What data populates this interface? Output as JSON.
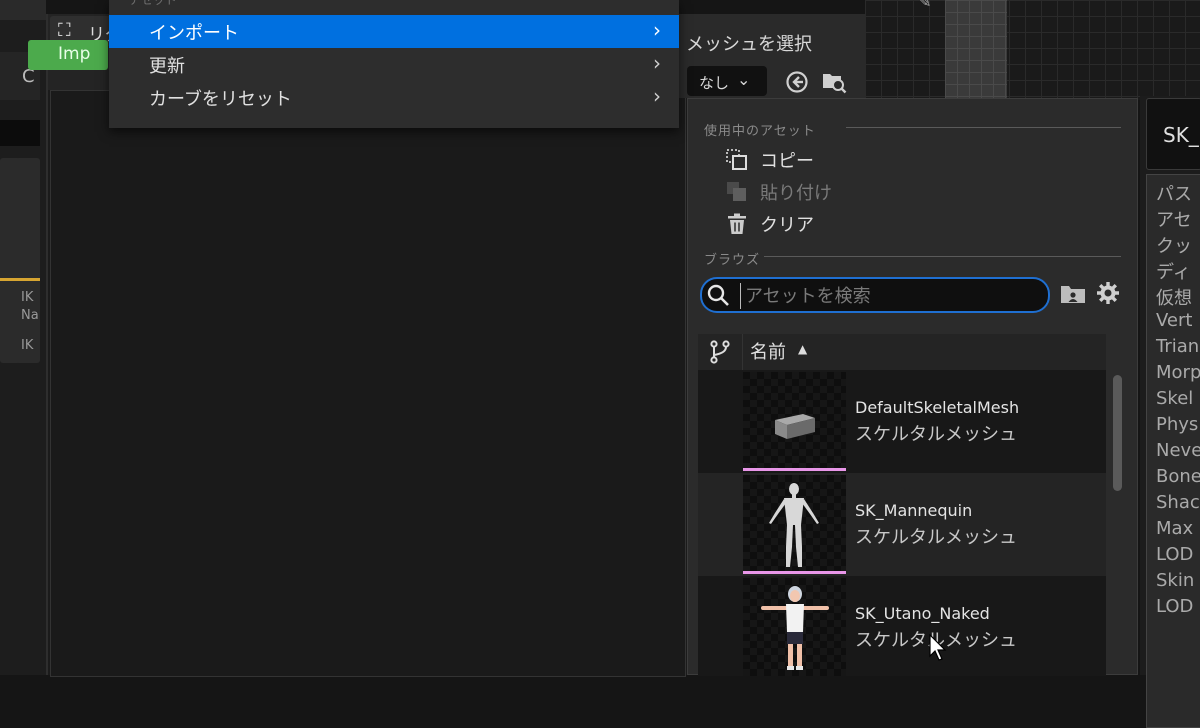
{
  "background": {
    "left_toolbar_letter": "C",
    "left_tab_icon": "retarget-icon",
    "left_tab_label": "リグ",
    "import_button_label": "Imp",
    "node_card_lines": [
      "IK",
      "Na",
      "IK"
    ]
  },
  "context_menu": {
    "section_label": "アセット",
    "items": [
      {
        "label": "インポート",
        "highlighted": true
      },
      {
        "label": "更新",
        "highlighted": false
      },
      {
        "label": "カーブをリセット",
        "highlighted": false
      }
    ]
  },
  "mesh_select": {
    "title": "メッシュを選択",
    "dropdown_value": "なし"
  },
  "asset_picker": {
    "current_asset_header": "使用中のアセット",
    "actions": [
      {
        "label": "コピー",
        "icon": "copy-icon",
        "enabled": true
      },
      {
        "label": "貼り付け",
        "icon": "paste-icon",
        "enabled": false
      },
      {
        "label": "クリア",
        "icon": "trash-icon",
        "enabled": true
      }
    ],
    "browse_header": "ブラウズ",
    "search": {
      "placeholder": "アセットを検索",
      "value": ""
    },
    "column_header": "名前",
    "assets": [
      {
        "name": "DefaultSkeletalMesh",
        "type": "スケルタルメッシュ",
        "thumbnail": "cube"
      },
      {
        "name": "SK_Mannequin",
        "type": "スケルタルメッシュ",
        "thumbnail": "mannequin"
      },
      {
        "name": "SK_Utano_Naked",
        "type": "スケルタルメッシュ",
        "thumbnail": "character"
      }
    ]
  },
  "details_panel": {
    "name_field": "SK_",
    "rows": [
      "パス",
      "アセ",
      "クッ",
      "ディ",
      "仮想",
      "Vert",
      "Trian",
      "Morp",
      "Skel",
      "Phys",
      "Neve",
      "Bone",
      "Shac",
      "Max",
      "LOD",
      "Skin",
      "LOD"
    ]
  },
  "colors": {
    "highlight": "#0070e0",
    "import_green": "#4caa4c",
    "search_border": "#1f6fd1",
    "thumbnail_underline": "#e896e8"
  }
}
